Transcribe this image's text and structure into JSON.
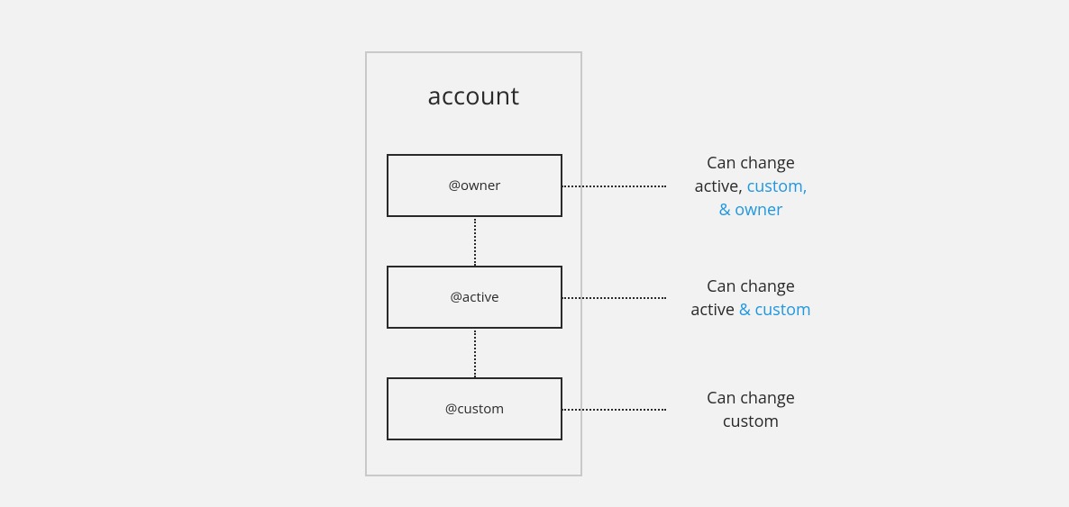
{
  "account": {
    "title": "account",
    "permissions": [
      {
        "label": "@owner"
      },
      {
        "label": "@active"
      },
      {
        "label": "@custom"
      }
    ]
  },
  "descriptions": {
    "owner": {
      "line1": "Can change",
      "line2a": "active, ",
      "line2b": "custom,",
      "line3": "& owner"
    },
    "active": {
      "line1": "Can change",
      "line2a": "active ",
      "line2b": "& custom"
    },
    "custom": {
      "line1": "Can change",
      "line2": "custom"
    }
  },
  "colors": {
    "highlight": "#1f97e0",
    "border_outer": "#c9c9c9",
    "text": "#2a2a2a",
    "bg": "#f2f2f2"
  }
}
